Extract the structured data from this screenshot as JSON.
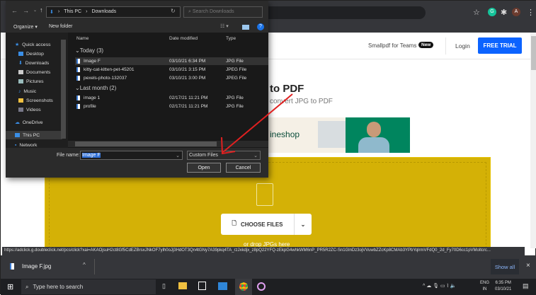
{
  "browser": {
    "profile_initial": "A",
    "extension": "G"
  },
  "site": {
    "teams": "Smallpdf for Teams",
    "new_badge": "New",
    "login": "Login",
    "free_trial": "FREE TRIAL",
    "title": "to PDF",
    "subtitle": "convert JPG to PDF",
    "ad_text": "ineshop",
    "choose_files": "CHOOSE FILES",
    "drop_hint": "or drop JPGs here"
  },
  "status_url": "https://adclick.g.doubleclick.net/pcs/click?xai=AKAOjsuH2ct8Gf5CdEZBrsxJNkOF7ylh0oJj3HdOT3Qn4tGNy7A39pkq4TA_rzJxkdjx_z8pQ22YFQ-zEkpG4whkWM6nP_PR5R2ZC-Sn1GlnDz3ojVVuwbZZcKp8CMAb3YPbYqlrmVFdQ0_2d_Fy70D6cc1pVMoltcrc...",
  "download": {
    "file": "Image F.jpg",
    "show_all": "Show all"
  },
  "taskbar": {
    "search": "Type here to search",
    "lang1": "ENG",
    "lang2": "IN",
    "time": "6:35 PM",
    "date": "03/10/21"
  },
  "dialog": {
    "path": [
      "This PC",
      "Downloads"
    ],
    "search_placeholder": "Search Downloads",
    "organize": "Organize ▾",
    "new_folder": "New folder",
    "sidebar": [
      "Quick access",
      "Desktop",
      "Downloads",
      "Documents",
      "Pictures",
      "Music",
      "Screenshots",
      "Videos",
      "OneDrive",
      "This PC",
      "Network"
    ],
    "columns": {
      "name": "Name",
      "date": "Date modified",
      "type": "Type"
    },
    "groups": [
      {
        "label": "Today (3)",
        "files": [
          {
            "name": "Image F",
            "date": "03/10/21 6:34 PM",
            "type": "JPG File"
          },
          {
            "name": "kitty-cat-kitten-pet-45201",
            "date": "03/10/21 3:15 PM",
            "type": "JPEG File"
          },
          {
            "name": "pexels-photo-132037",
            "date": "03/10/21 3:00 PM",
            "type": "JPEG File"
          }
        ]
      },
      {
        "label": "Last month (2)",
        "files": [
          {
            "name": "image 1",
            "date": "02/17/21 11:21 PM",
            "type": "JPG File"
          },
          {
            "name": "profile",
            "date": "02/17/21 11:21 PM",
            "type": "JPG File"
          }
        ]
      }
    ],
    "file_name_label": "File name:",
    "file_name_value": "Image F",
    "file_type": "Custom Files",
    "open": "Open",
    "cancel": "Cancel"
  }
}
